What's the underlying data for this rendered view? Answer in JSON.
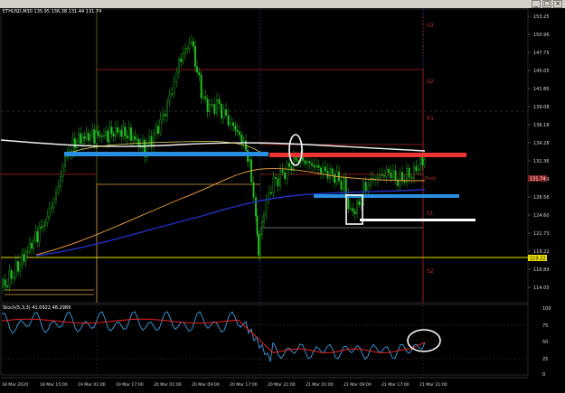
{
  "window": {
    "buttons": [
      "_",
      "□",
      "×"
    ]
  },
  "main_chart": {
    "caption": "ETHUSD,M30  135.95 136.38 131.44 131.74",
    "current_price_label": "131.74",
    "yellow_level_label": "119.22",
    "pivot_labels": [
      "S3",
      "S2",
      "R1",
      "S1",
      "S2"
    ],
    "inline_label": "Pivot",
    "y_ticks": [
      "153.25",
      "150.96",
      "147.75",
      "145.05",
      "141.80",
      "139.08",
      "136.18",
      "134.28",
      "131.36",
      "128.49",
      "126.56",
      "124.60",
      "121.73",
      "119.22",
      "116.89",
      "114.05"
    ]
  },
  "sub_chart": {
    "caption": "Stoch(5,3,3) 41.0922 48.2989",
    "y_ticks": [
      "100",
      "75",
      "50",
      "25",
      "0"
    ]
  },
  "time_axis": {
    "labels": [
      "18 Mar 2020",
      "18 Mar 15:00",
      "19 Mar 01:00",
      "19 Mar 17:00",
      "20 Mar 01:00",
      "20 Mar 09:00",
      "20 Mar 17:00",
      "20 Mar 21:00",
      "21 Mar 01:00",
      "21 Mar 09:00",
      "21 Mar 17:00",
      "21 Mar 21:00"
    ]
  },
  "colors": {
    "background": "#000000",
    "candles": "#22bb22",
    "blue_bar": "#2a8fe0",
    "red_bar": "#ee3333",
    "white_bar": "#ffffff",
    "yellow_line": "#e8e000",
    "ma_white": "#f0f0f0",
    "ma_orange": "#f0a040",
    "ma_blue": "#2030c0",
    "stoch_main": "#40b0ff",
    "stoch_signal": "#ee2222"
  }
}
